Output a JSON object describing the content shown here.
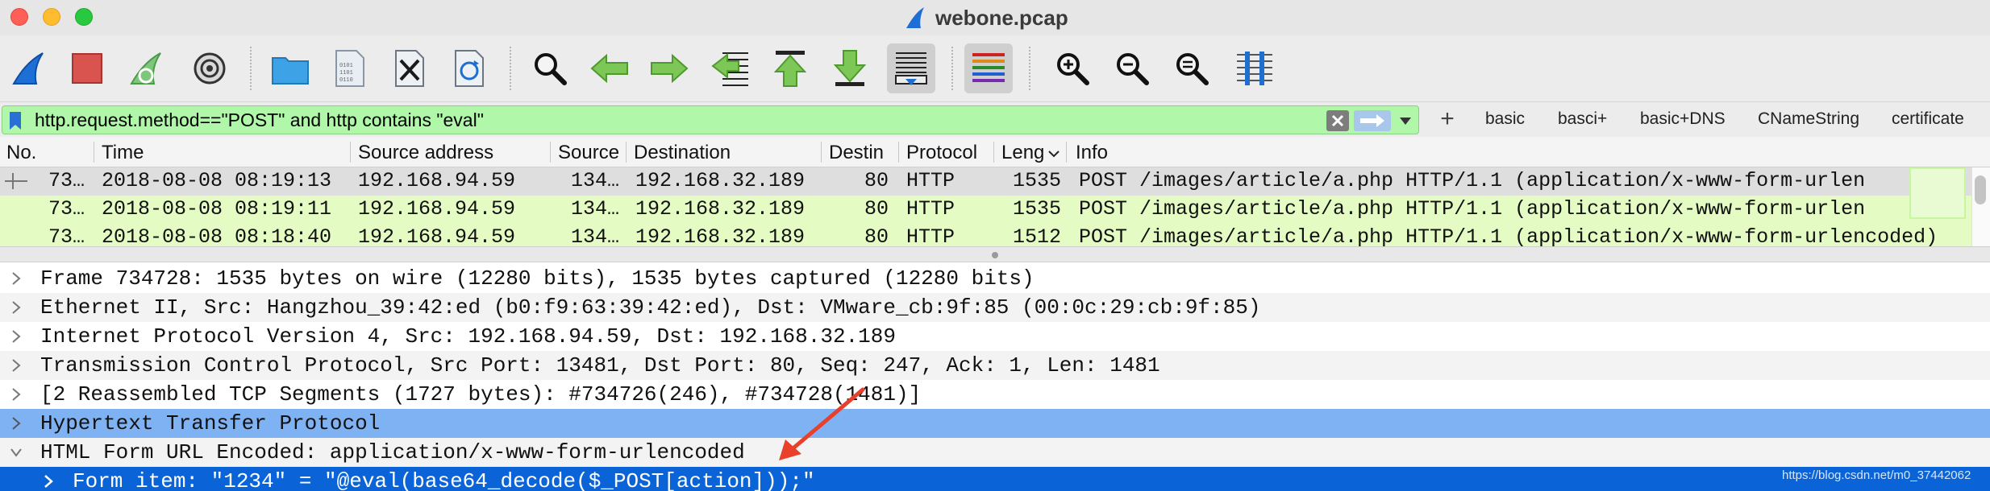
{
  "window": {
    "title": "webone.pcap"
  },
  "toolbar": {
    "buttons": [
      {
        "icon": "shark-fin-icon"
      },
      {
        "icon": "stop-square-icon"
      },
      {
        "icon": "restart-fin-icon"
      },
      {
        "icon": "gear-icon"
      },
      {
        "icon": "folder-icon"
      },
      {
        "icon": "binary-file-icon"
      },
      {
        "icon": "close-file-icon"
      },
      {
        "icon": "reload-file-icon"
      },
      {
        "icon": "search-icon"
      },
      {
        "icon": "arrow-left-icon"
      },
      {
        "icon": "arrow-right-icon"
      },
      {
        "icon": "go-to-packet-icon"
      },
      {
        "icon": "first-packet-icon"
      },
      {
        "icon": "last-packet-icon"
      },
      {
        "icon": "autoscroll-icon"
      },
      {
        "icon": "colorize-icon"
      },
      {
        "icon": "zoom-in-icon"
      },
      {
        "icon": "zoom-out-icon"
      },
      {
        "icon": "zoom-normal-icon"
      },
      {
        "icon": "resize-columns-icon"
      }
    ]
  },
  "filter": {
    "value": "http.request.method==\"POST\" and http contains \"eval\"",
    "bg_color": "#b0f7a9",
    "add_label": "+",
    "buttons": [
      "basic",
      "basci+",
      "basic+DNS",
      "CNameString",
      "certificate"
    ]
  },
  "packet_list": {
    "columns": [
      "No.",
      "Time",
      "Source address",
      "Source",
      "Destination",
      "Destin",
      "Protocol",
      "Leng",
      "Info"
    ],
    "rows": [
      {
        "no": "73…",
        "time": "2018-08-08 08:19:13",
        "src": "192.168.94.59",
        "sport": "134…",
        "dst": "192.168.32.189",
        "dport": "80",
        "proto": "HTTP",
        "len": "1535",
        "info": "POST /images/article/a.php HTTP/1.1  (application/x-www-form-urlen"
      },
      {
        "no": "73…",
        "time": "2018-08-08 08:19:11",
        "src": "192.168.94.59",
        "sport": "134…",
        "dst": "192.168.32.189",
        "dport": "80",
        "proto": "HTTP",
        "len": "1535",
        "info": "POST /images/article/a.php HTTP/1.1  (application/x-www-form-urlen"
      },
      {
        "no": "73…",
        "time": "2018-08-08 08:18:40",
        "src": "192.168.94.59",
        "sport": "134…",
        "dst": "192.168.32.189",
        "dport": "80",
        "proto": "HTTP",
        "len": "1512",
        "info": "POST /images/article/a.php HTTP/1.1  (application/x-www-form-urlencoded)"
      }
    ],
    "colors": {
      "selected": "#dedede",
      "http": "#e4fcc4"
    }
  },
  "details": {
    "rows": [
      {
        "text": "Frame 734728: 1535 bytes on wire (12280 bits), 1535 bytes captured (12280 bits)",
        "expanded": false
      },
      {
        "text": "Ethernet II, Src: Hangzhou_39:42:ed (b0:f9:63:39:42:ed), Dst: VMware_cb:9f:85 (00:0c:29:cb:9f:85)",
        "expanded": false
      },
      {
        "text": "Internet Protocol Version 4, Src: 192.168.94.59, Dst: 192.168.32.189",
        "expanded": false
      },
      {
        "text": "Transmission Control Protocol, Src Port: 13481, Dst Port: 80, Seq: 247, Ack: 1, Len: 1481",
        "expanded": false
      },
      {
        "text": "[2 Reassembled TCP Segments (1727 bytes): #734726(246), #734728(1481)]",
        "expanded": false
      },
      {
        "text": "Hypertext Transfer Protocol",
        "expanded": false
      },
      {
        "text": "HTML Form URL Encoded: application/x-www-form-urlencoded",
        "expanded": true
      },
      {
        "text": "Form item: \"1234\" = \"@eval(base64_decode($_POST[action]));\"",
        "expanded": false
      }
    ],
    "colors": {
      "highlight": "#7fb2f3",
      "selected": "#0a64d8"
    }
  },
  "watermark": "https://blog.csdn.net/m0_37442062"
}
